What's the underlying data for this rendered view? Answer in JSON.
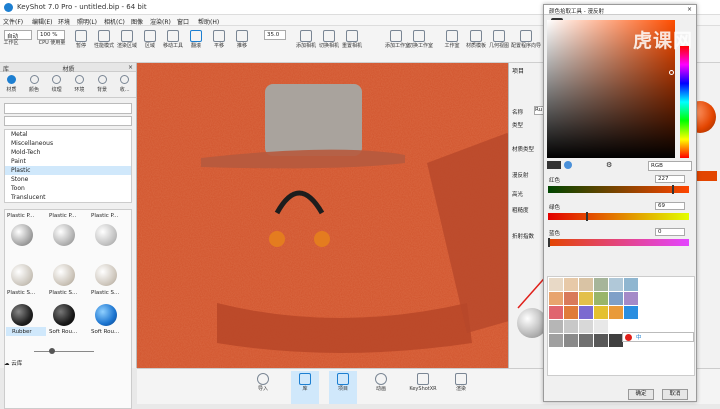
{
  "window": {
    "title": "KeyShot 7.0 Pro - untitled.bip - 64 bit"
  },
  "menu": [
    "文件(F)",
    "编辑(E)",
    "环境",
    "照明(L)",
    "相机(C)",
    "图像",
    "渲染(R)",
    "窗口",
    "帮助(H)"
  ],
  "toolbar": {
    "mode_value": "自动",
    "zoom_value": "100 %",
    "focal_value": "35.0",
    "buttons": [
      "工作区",
      "CPU 使用量",
      "暂停",
      "性能模式",
      "渲染区域",
      "区域",
      "移动工具",
      "翻滚",
      "平移",
      "推移",
      "添加相机",
      "切换相机",
      "重置相机",
      "添加工作室",
      "切换工作室",
      "工作室",
      "材质模板",
      "几何视图",
      "配置程序向导"
    ]
  },
  "left_panel": {
    "header": "库",
    "section": "材质",
    "tabs": [
      "材质",
      "颜色",
      "纹理",
      "环境",
      "背景",
      "收..."
    ],
    "tree": [
      "Metal",
      "Miscellaneous",
      "Mold-Tech",
      "Paint",
      "Plastic",
      "Stone",
      "Toon",
      "Translucent"
    ],
    "tree_selected": "Plastic",
    "thumb_labels": [
      "Plastic P...",
      "Plastic P...",
      "Plastic P...",
      "Plastic S...",
      "Plastic S...",
      "Plastic S...",
      "Rubber",
      "Soft Rou...",
      "Soft Rou..."
    ],
    "footer": "云库"
  },
  "right_panel": {
    "header": "项目",
    "labels": [
      "名称",
      "类型",
      "材质类型",
      "漫反射",
      "高光",
      "粗糙度",
      "折射指数"
    ],
    "name_value": "Ru"
  },
  "bottom_bar": [
    "导入",
    "库",
    "项目",
    "动画",
    "KeyShotXR",
    "渲染"
  ],
  "color_picker": {
    "title": "颜色拾取工具 - 漫反射",
    "mode": "RGB",
    "channels": [
      {
        "label": "红色",
        "value": "227",
        "fraction": 0.89
      },
      {
        "label": "绿色",
        "value": "69",
        "fraction": 0.27
      },
      {
        "label": "蓝色",
        "value": "0",
        "fraction": 0.0
      }
    ],
    "ok": "确定",
    "cancel": "取消",
    "selected_hex": "#e34500",
    "watermark": "虎课网"
  },
  "ime_toolbar": {
    "label": "中"
  }
}
